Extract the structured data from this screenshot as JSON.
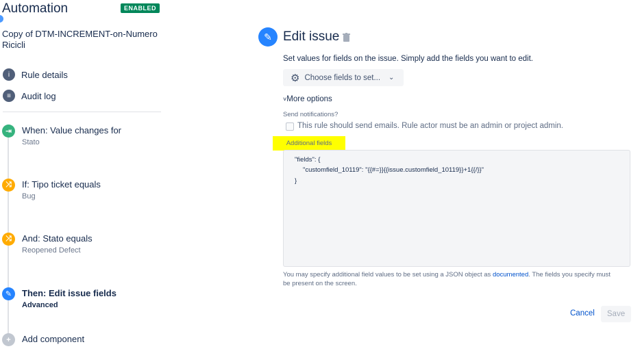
{
  "app": {
    "title": "Automation",
    "status_badge": "ENABLED"
  },
  "rule": {
    "name": "Copy of DTM-INCREMENT-on-Numero Ricicli"
  },
  "nav": [
    {
      "label": "Rule details",
      "icon": "info-icon"
    },
    {
      "label": "Audit log",
      "icon": "list-icon"
    }
  ],
  "steps": [
    {
      "title": "When: Value changes for",
      "subtitle": "Stato",
      "icon": "trigger-icon",
      "color": "#36b37e"
    },
    {
      "title": "If: Tipo ticket equals",
      "subtitle": "Bug",
      "icon": "condition-icon",
      "color": "#ffab00"
    },
    {
      "title": "And: Stato equals",
      "subtitle": "Reopened Defect",
      "icon": "condition-icon",
      "color": "#ffab00"
    },
    {
      "title": "Then: Edit issue fields",
      "subtitle": "Advanced",
      "icon": "pencil-icon",
      "color": "#2684ff"
    },
    {
      "title": "Add component",
      "icon": "plus-icon",
      "color": "#c1c7d0"
    }
  ],
  "editor": {
    "title": "Edit issue",
    "description": "Set values for fields on the issue. Simply add the fields you want to edit.",
    "choose_fields_label": "Choose fields to set...",
    "more_options_label": "More options",
    "send_notifications_label": "Send notifications?",
    "send_notifications_checkbox_label": "This rule should send emails. Rule actor must be an admin or project admin.",
    "send_notifications_checked": false,
    "additional_fields_label": "Additional fields",
    "additional_fields_value": [
      "\"fields\": {",
      "\"customfield_10119\": \"{{#=}}{{issue.customfield_10119}}+1{{/}}\"",
      "}"
    ],
    "help_text_before_link": "You may specify additional field values to be set using a JSON object as ",
    "help_link_text": "documented",
    "help_text_after_link": ". The fields you specify must",
    "help_text_line2": "be present on the screen.",
    "cancel_label": "Cancel",
    "save_label": "Save"
  },
  "colors": {
    "accent": "#2684ff",
    "badge": "#00875a",
    "highlight": "#ffff00",
    "link": "#0052cc"
  }
}
